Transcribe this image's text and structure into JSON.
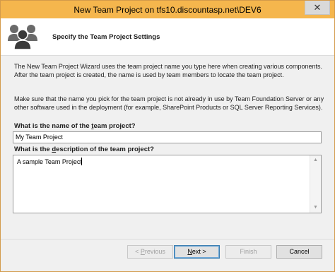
{
  "window": {
    "title": "New Team Project on tfs10.discountasp.net\\DEV6",
    "close_glyph": "✕",
    "title_bar_color": "#f5b64d"
  },
  "header": {
    "icon": "team-users-icon",
    "title": "Specify the Team Project Settings"
  },
  "body": {
    "paragraph1": "The New Team Project Wizard uses the team project name you type here when creating various components. After the team project is created, the name is used by team members to locate the team project.",
    "paragraph2": "Make sure that the name you pick for the team project is not already in use by Team Foundation Server or any other software used in the deployment (for example, SharePoint Products or SQL Server Reporting Services)."
  },
  "fields": {
    "name_label_a": "What is the name of the ",
    "name_label_u": "t",
    "name_label_b": "eam project?",
    "name_value": "My Team Project",
    "description_label_a": "What is the ",
    "description_label_u": "d",
    "description_label_b": "escription of the team project?",
    "description_value": "A sample Team Project"
  },
  "buttons": {
    "previous_prefix": "< ",
    "previous_u": "P",
    "previous_rest": "revious",
    "next_u": "N",
    "next_rest": "ext >",
    "finish": "Finish",
    "cancel": "Cancel"
  },
  "colors": {
    "accent_border": "#3c7fb1",
    "disabled_text": "#a0a0a0"
  }
}
